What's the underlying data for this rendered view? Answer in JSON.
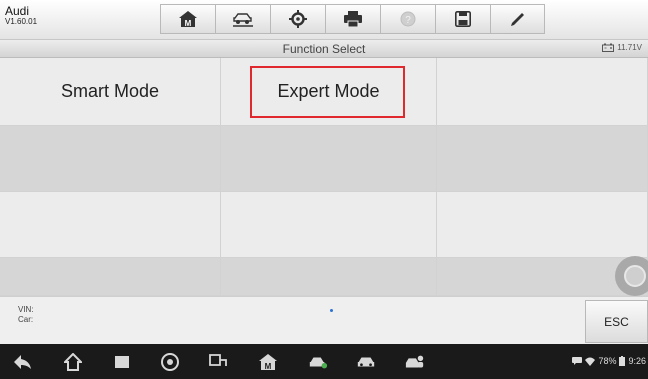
{
  "vehicle": {
    "make": "Audi",
    "version": "V1.60.01"
  },
  "toolbar": {
    "buttons": [
      {
        "icon": "home-icon"
      },
      {
        "icon": "vehicle-lift-icon"
      },
      {
        "icon": "settings-gear-icon"
      },
      {
        "icon": "print-icon"
      },
      {
        "icon": "help-icon"
      },
      {
        "icon": "save-icon"
      },
      {
        "icon": "pen-icon"
      }
    ]
  },
  "title_bar": {
    "title": "Function Select",
    "battery_voltage": "11.71V"
  },
  "functions": {
    "items": [
      "Smart Mode",
      "Expert Mode"
    ],
    "highlighted": "Expert Mode"
  },
  "info": {
    "vin_label": "VIN:",
    "car_label": "Car:"
  },
  "esc_label": "ESC",
  "android_status": {
    "battery_percent": "78%",
    "time": "9:26"
  },
  "colors": {
    "highlight": "#e0292f",
    "page_indicator": "#2b73d6",
    "nav_bar": "#1a1a1a"
  }
}
